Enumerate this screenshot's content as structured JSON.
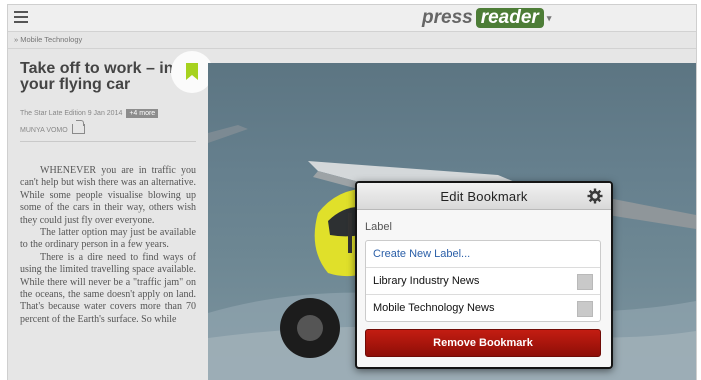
{
  "app": {
    "logo_part1": "press",
    "logo_part2": "reader",
    "logo_caret": "▾"
  },
  "breadcrumb": "» Mobile Technology",
  "article": {
    "headline": "Take off to work – in your flying car",
    "source": "The Star Late Edition",
    "date": "9 Jan 2014",
    "more_label": "+4 more",
    "author": "MUNYA VOMO",
    "paragraphs": [
      "WHENEVER you are in traffic you can't help but wish there was an alternative. While some people visualise blowing up some of the cars in their way, others wish they could just fly over everyone.",
      "The latter option may just be available to the ordinary person in a few years.",
      "There is a dire need to find ways of using the limited travelling space available. While there will never be a \"traffic jam\" on the oceans, the same doesn't apply on land. That's because water covers more than 70 percent of the Earth's surface. So while"
    ]
  },
  "icons": {
    "menu": "menu-icon",
    "bookmark": "bookmark-icon",
    "share": "share-icon",
    "gear": "gear-icon",
    "bookmark_color": "#a6d21e"
  },
  "dialog": {
    "title": "Edit Bookmark",
    "label_heading": "Label",
    "create_label": "Create New Label...",
    "labels": [
      {
        "name": "Library Industry News",
        "checked": false
      },
      {
        "name": "Mobile Technology News",
        "checked": false
      }
    ],
    "remove_button": "Remove Bookmark",
    "remove_color": "#b0170e"
  }
}
